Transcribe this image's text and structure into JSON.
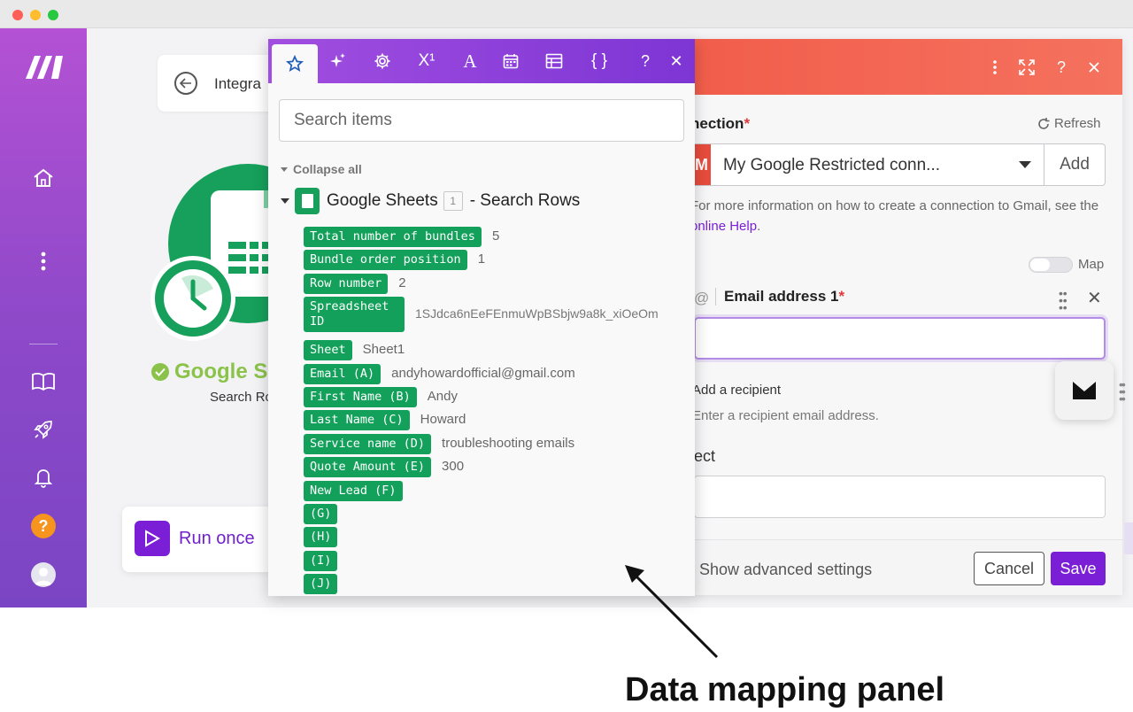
{
  "canvas": {
    "back_label": "Integra",
    "module_title": "Google S",
    "module_subtitle": "Search Ro",
    "run_once_label": "Run once"
  },
  "settings": {
    "connection_label": "nection",
    "required_mark": "*",
    "refresh_label": "Refresh",
    "connection_value": "My Google Restricted conn...",
    "add_label": "Add",
    "help_text_prefix": "For more information on how to create a connection to Gmail, see the ",
    "help_link": "online Help",
    "help_text_suffix": ".",
    "map_label": "Map",
    "email_label": "Email address 1",
    "add_recipient_label": "Add a recipient",
    "recipient_hint": "Enter a recipient email address.",
    "subject_label": "ject",
    "advanced_label": "Show advanced settings",
    "cancel_label": "Cancel",
    "save_label": "Save"
  },
  "mapping_panel": {
    "search_placeholder": "Search items",
    "collapse_all_label": "Collapse all",
    "module_name": "Google Sheets",
    "module_badge": "1",
    "module_action": "- Search Rows",
    "tabs": [
      "star-icon",
      "sparkle-icon",
      "gear-icon",
      "superscript-icon",
      "text-icon",
      "calendar-icon",
      "table-icon",
      "braces-icon",
      "help-icon",
      "close-icon"
    ],
    "items": [
      {
        "label": "Total number of bundles",
        "value": "5"
      },
      {
        "label": "Bundle order position",
        "value": "1"
      },
      {
        "label": "Row number",
        "value": "2"
      },
      {
        "label": "Spreadsheet ID",
        "value": "1SJdca6nEeFEnmuWpBSbjw9a8k_xiOeOm"
      },
      {
        "label": "Sheet",
        "value": "Sheet1"
      },
      {
        "label": "Email (A)",
        "value": "andyhowardofficial@gmail.com"
      },
      {
        "label": "First Name (B)",
        "value": "Andy"
      },
      {
        "label": "Last Name (C)",
        "value": "Howard"
      },
      {
        "label": "Service name (D)",
        "value": "troubleshooting emails"
      },
      {
        "label": "Quote Amount (E)",
        "value": "300"
      },
      {
        "label": "New Lead (F)",
        "value": ""
      },
      {
        "label": "(G)",
        "value": ""
      },
      {
        "label": "(H)",
        "value": ""
      },
      {
        "label": "(I)",
        "value": ""
      },
      {
        "label": "(J)",
        "value": ""
      }
    ]
  },
  "annotation": {
    "caption": "Data mapping panel"
  },
  "colors": {
    "brand_purple": "#7a1fd6",
    "gmail_red": "#f25d4b",
    "sheets_green": "#12a05a",
    "help_orange": "#f7941d"
  }
}
